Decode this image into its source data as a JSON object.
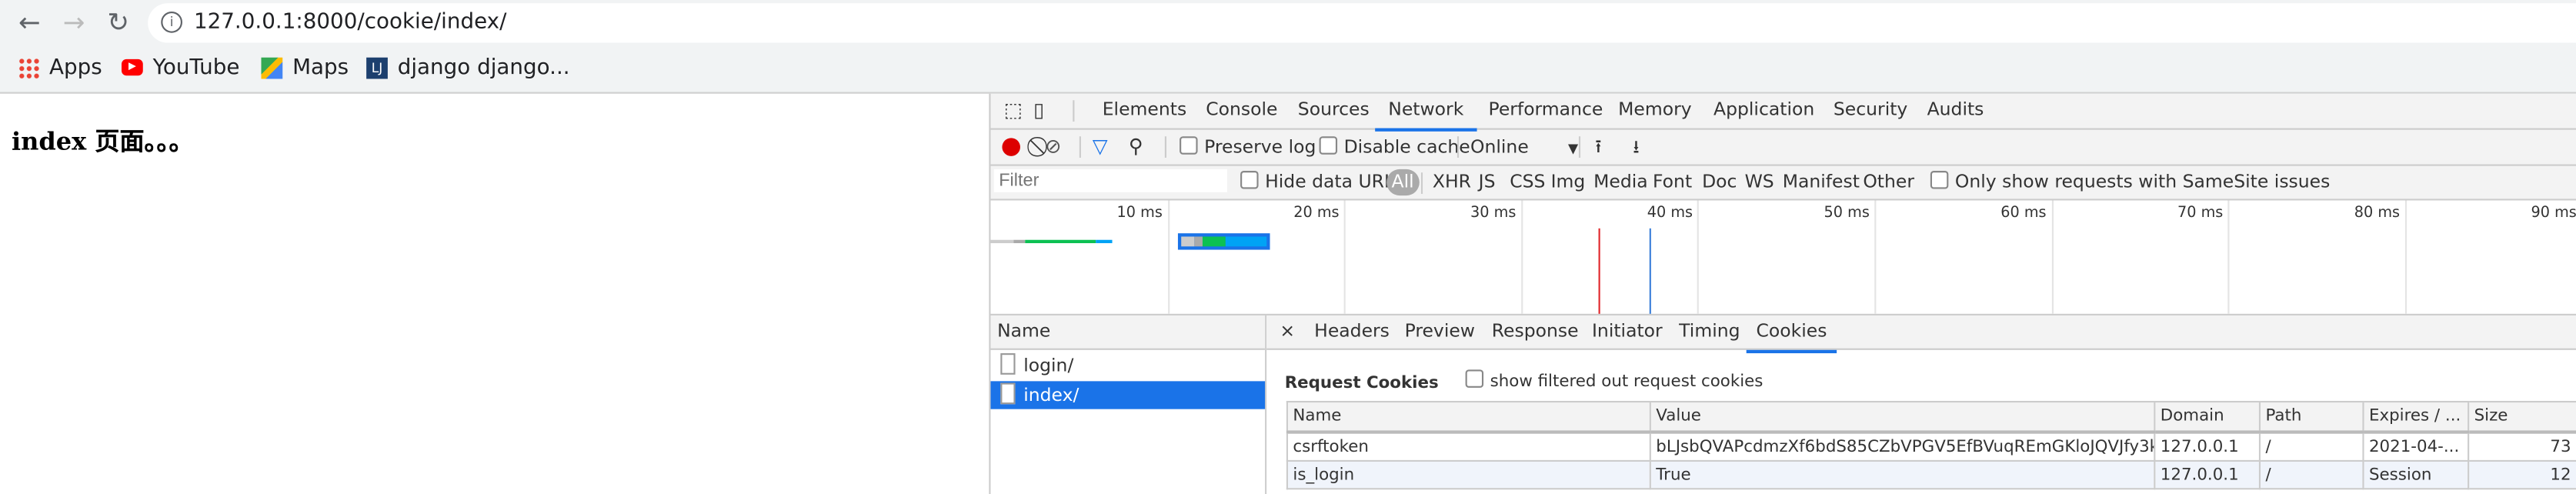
{
  "browser": {
    "url": "127.0.0.1:8000/cookie/index/",
    "bookmarks": [
      {
        "label": "Apps",
        "icon": "apps-grid-icon"
      },
      {
        "label": "YouTube",
        "icon": "youtube-icon"
      },
      {
        "label": "Maps",
        "icon": "maps-icon"
      },
      {
        "label": "django django...",
        "icon": "lj-icon"
      }
    ]
  },
  "page": {
    "heading": "index 页面。。。"
  },
  "devtools": {
    "tabs": [
      "Elements",
      "Console",
      "Sources",
      "Network",
      "Performance",
      "Memory",
      "Application",
      "Security",
      "Audits"
    ],
    "active_tab": "Network",
    "toolbar": {
      "preserve_log": "Preserve log",
      "disable_cache": "Disable cache",
      "throttling": "Online"
    },
    "filter": {
      "placeholder": "Filter",
      "hide_data_urls": "Hide data URLs",
      "types": [
        "All",
        "XHR",
        "JS",
        "CSS",
        "Img",
        "Media",
        "Font",
        "Doc",
        "WS",
        "Manifest",
        "Other"
      ],
      "samesite": "Only show requests with SameSite issues"
    },
    "timeline": {
      "ticks": [
        "10 ms",
        "20 ms",
        "30 ms",
        "40 ms",
        "50 ms",
        "60 ms",
        "70 ms",
        "80 ms",
        "90 ms"
      ],
      "dom_content_loaded_ms": 34.4,
      "load_ms": 37.3,
      "colors": {
        "red": "#e0272b",
        "blue": "#3b7fd9",
        "green": "#0cc152",
        "waiting": "#00a3f5"
      }
    },
    "requests": {
      "header": "Name",
      "items": [
        "login/",
        "index/"
      ],
      "selected": "index/"
    },
    "detail": {
      "close": "×",
      "tabs": [
        "Headers",
        "Preview",
        "Response",
        "Initiator",
        "Timing",
        "Cookies"
      ],
      "active_tab": "Cookies",
      "section_title": "Request Cookies",
      "show_filtered": "show filtered out request cookies",
      "columns": [
        "Name",
        "Value",
        "Domain",
        "Path",
        "Expires / ...",
        "Size"
      ],
      "rows": [
        [
          "csrftoken",
          "bLJsbQVAPcdmzXf6bdS85CZbVPGV5EfBVuqREmGKloJQVJfy3k...",
          "127.0.0.1",
          "/",
          "2021-04-...",
          "73"
        ],
        [
          "is_login",
          "True",
          "127.0.0.1",
          "/",
          "Session",
          "12"
        ]
      ]
    }
  }
}
